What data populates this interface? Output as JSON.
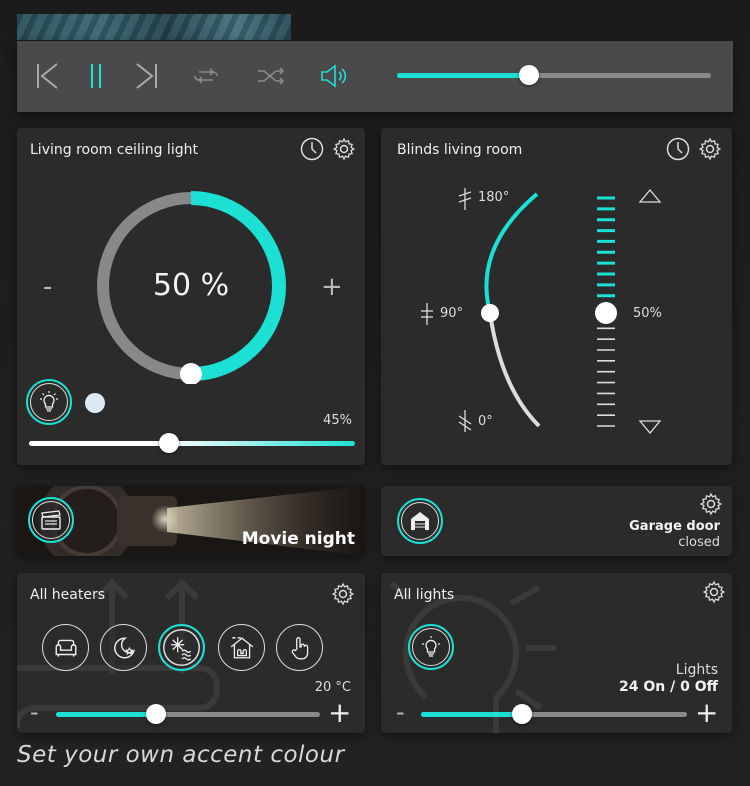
{
  "media": {
    "volume_percent": 42
  },
  "ceiling_light": {
    "title": "Living room ceiling light",
    "brightness_label": "50 %",
    "brightness_percent": 50,
    "minus_label": "-",
    "plus_label": "+",
    "warmth_label": "45%",
    "warmth_percent": 43
  },
  "blinds": {
    "title": "Blinds living room",
    "angle_180_label": "180°",
    "angle_90_label": "90°",
    "angle_0_label": "0°",
    "position_label": "50%",
    "position_percent": 50
  },
  "scene": {
    "label": "Movie night"
  },
  "garage": {
    "title": "Garage door",
    "status": "closed"
  },
  "heaters": {
    "title": "All heaters",
    "temperature": "20 °C",
    "minus_label": "-",
    "plus_label": "+",
    "modes": [
      "comfort-icon",
      "night-icon",
      "frost-icon",
      "away-icon",
      "manual-icon"
    ],
    "active_mode": "frost-icon",
    "setpoint_percent": 38
  },
  "lights": {
    "title": "All lights",
    "caption": "Lights",
    "summary": "24 On / 0 Off",
    "minus_label": "-",
    "plus_label": "+",
    "level_percent": 38
  },
  "tagline": "Set your own accent colour",
  "colors": {
    "accent": "#1be0d3",
    "card": "#2b2b2b",
    "media_bar": "#4a4a4a",
    "background": "#1f1f1f"
  }
}
